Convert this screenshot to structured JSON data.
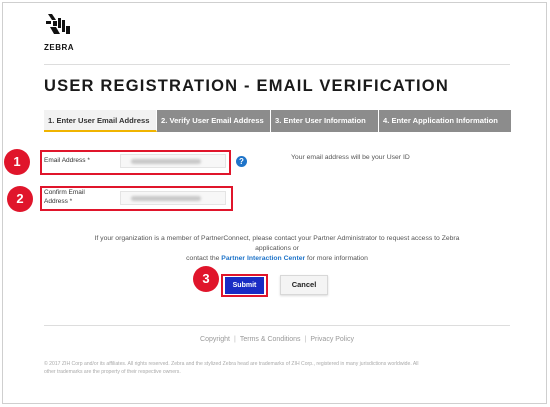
{
  "brand": {
    "name": "ZEBRA"
  },
  "page": {
    "title": "USER REGISTRATION - EMAIL VERIFICATION"
  },
  "steps": [
    {
      "label": "1. Enter User Email Address",
      "active": true
    },
    {
      "label": "2. Verify User Email Address",
      "active": false
    },
    {
      "label": "3. Enter User Information",
      "active": false
    },
    {
      "label": "4. Enter Application Information",
      "active": false
    }
  ],
  "form": {
    "email_label": "Email Address *",
    "confirm_label_line1": "Confirm Email",
    "confirm_label_line2": "Address *",
    "help_glyph": "?",
    "hint": "Your email address will be your User ID"
  },
  "info": {
    "line1": "If your organization is a member of PartnerConnect, please contact your Partner Administrator to request access to Zebra",
    "line2": "applications or",
    "line3_prefix": "contact the ",
    "line3_link": "Partner Interaction Center",
    "line3_suffix": " for more information"
  },
  "buttons": {
    "submit": "Submit",
    "cancel": "Cancel"
  },
  "markers": {
    "one": "1",
    "two": "2",
    "three": "3"
  },
  "footer": {
    "copyright": "Copyright",
    "terms": "Terms & Conditions",
    "privacy": "Privacy Policy",
    "separator": "|",
    "legal_line1": "© 2017 ZIH Corp and/or its affiliates. All rights reserved. Zebra and the stylized Zebra head are trademarks of ZIH Corp., registered in many jurisdictions worldwide. All",
    "legal_line2": "other trademarks are the property of their respective owners."
  },
  "colors": {
    "highlight": "#e0152b",
    "submit": "#1a2cc4",
    "link": "#1f74c9",
    "active_tab_underline": "#f0b400"
  }
}
